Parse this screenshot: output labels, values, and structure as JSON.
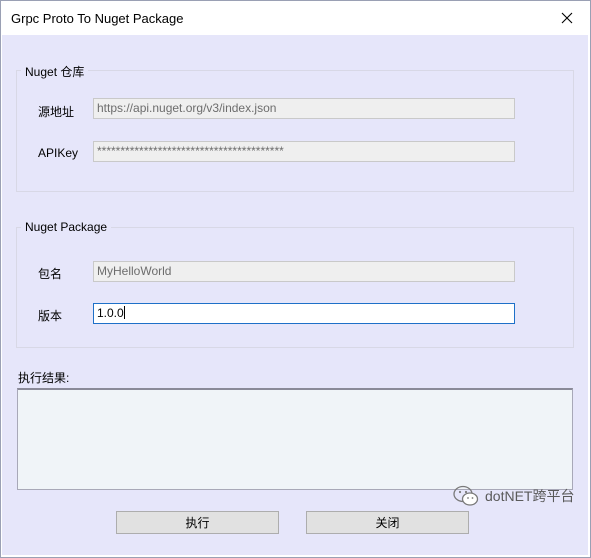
{
  "window": {
    "title": "Grpc Proto To Nuget Package"
  },
  "nuget_repo": {
    "legend": "Nuget 仓库",
    "source_label": "源地址",
    "source_value": "https://api.nuget.org/v3/index.json",
    "apikey_label": "APIKey",
    "apikey_value": "****************************************"
  },
  "nuget_package": {
    "legend": "Nuget Package",
    "name_label": "包名",
    "name_placeholder": "MyHelloWorld",
    "version_label": "版本",
    "version_value": "1.0.0"
  },
  "result": {
    "label": "执行结果:"
  },
  "buttons": {
    "execute": "执行",
    "close": "关闭"
  },
  "watermark": {
    "text": "dotNET跨平台",
    "icon": "wechat-icon"
  },
  "colors": {
    "client_bg": "#e6e6fa",
    "active_border": "#1e70c8"
  }
}
